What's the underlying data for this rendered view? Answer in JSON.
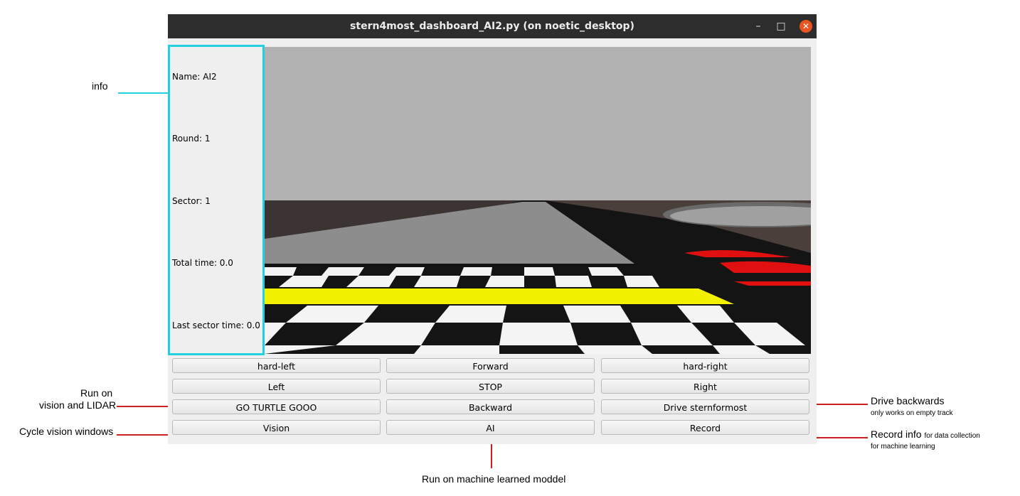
{
  "window": {
    "title": "stern4most_dashboard_AI2.py (on noetic_desktop)",
    "minimize_glyph": "–",
    "maximize_glyph": "□",
    "close_glyph": "✕"
  },
  "info": {
    "name": "Name: AI2",
    "round": "Round: 1",
    "sector": "Sector: 1",
    "total_time": "Total time: 0.0",
    "last_sector_time": "Last sector time: 0.0"
  },
  "buttons": {
    "hard_left": "hard-left",
    "forward": "Forward",
    "hard_right": "hard-right",
    "left": "Left",
    "stop": "STOP",
    "right": "Right",
    "go_turtle": "GO TURTLE GOOO",
    "backward": "Backward",
    "drive_sternformost": "Drive sternformost",
    "vision": "Vision",
    "ai": "AI",
    "record": "Record"
  },
  "annotations": {
    "info": "info",
    "run_on_line1": "Run on",
    "run_on_line2": "vision and LIDAR",
    "cycle_vision": "Cycle vision windows",
    "drive_backwards": "Drive backwards",
    "drive_backwards_note": "only works on empty track",
    "record_info": "Record info",
    "record_info_note1": "for data collection",
    "record_info_note2": "for machine learning",
    "run_ml": "Run on machine learned moddel"
  },
  "colors": {
    "info_border": "#22d0e0",
    "annotation_line_info": "#22d0e0",
    "annotation_line": "#cc1f1f",
    "close_button": "#e95420",
    "titlebar": "#2d2d2d"
  }
}
